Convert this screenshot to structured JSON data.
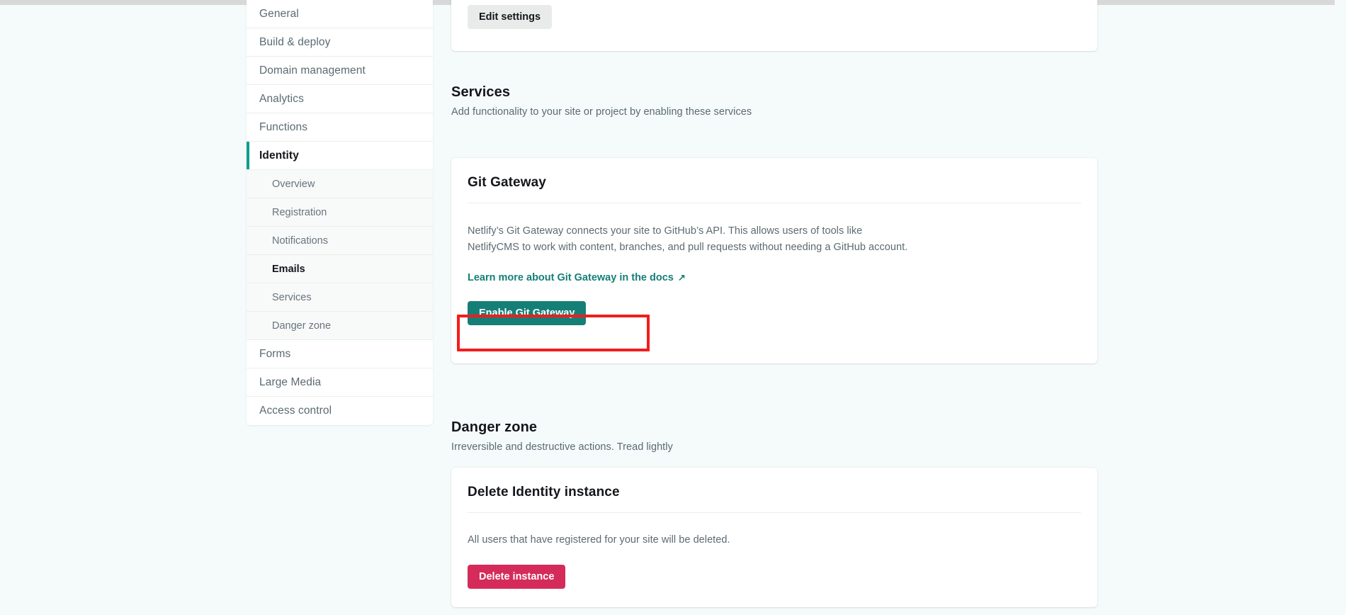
{
  "colors": {
    "page_background": "#f5fafa",
    "accent_teal": "#157f77",
    "active_indicator": "#0e9e8f",
    "danger_pink": "#d52b5b",
    "annotation_red": "#f41c1c",
    "card_background": "#ffffff"
  },
  "sidebar": {
    "items": [
      {
        "label": "General",
        "type": "top",
        "state": "default"
      },
      {
        "label": "Build & deploy",
        "type": "top",
        "state": "default"
      },
      {
        "label": "Domain management",
        "type": "top",
        "state": "default"
      },
      {
        "label": "Analytics",
        "type": "top",
        "state": "default"
      },
      {
        "label": "Functions",
        "type": "top",
        "state": "default"
      },
      {
        "label": "Identity",
        "type": "top",
        "state": "active"
      },
      {
        "label": "Overview",
        "type": "sub",
        "state": "default"
      },
      {
        "label": "Registration",
        "type": "sub",
        "state": "default"
      },
      {
        "label": "Notifications",
        "type": "sub",
        "state": "default"
      },
      {
        "label": "Emails",
        "type": "sub",
        "state": "selected"
      },
      {
        "label": "Services",
        "type": "sub",
        "state": "default"
      },
      {
        "label": "Danger zone",
        "type": "sub",
        "state": "default"
      },
      {
        "label": "Forms",
        "type": "top",
        "state": "default"
      },
      {
        "label": "Large Media",
        "type": "top",
        "state": "default"
      },
      {
        "label": "Access control",
        "type": "top",
        "state": "default"
      }
    ]
  },
  "main": {
    "top_card": {
      "edit_settings_label": "Edit settings"
    },
    "services_section": {
      "title": "Services",
      "subtitle": "Add functionality to your site or project by enabling these services",
      "git_gateway": {
        "title": "Git Gateway",
        "body": "Netlify’s Git Gateway connects your site to GitHub’s API. This allows users of tools like NetlifyCMS to work with content, branches, and pull requests without needing a GitHub account.",
        "docs_link_label": "Learn more about Git Gateway in the docs",
        "docs_link_icon": "external-link-arrow-icon",
        "enable_button_label": "Enable Git Gateway"
      }
    },
    "danger_section": {
      "title": "Danger zone",
      "subtitle": "Irreversible and destructive actions. Tread lightly",
      "delete_card": {
        "title": "Delete Identity instance",
        "body": "All users that have registered for your site will be deleted.",
        "delete_button_label": "Delete instance"
      }
    }
  },
  "annotation": {
    "target": "enable-git-gateway-button",
    "shape": "rectangle",
    "color": "#f41c1c"
  }
}
